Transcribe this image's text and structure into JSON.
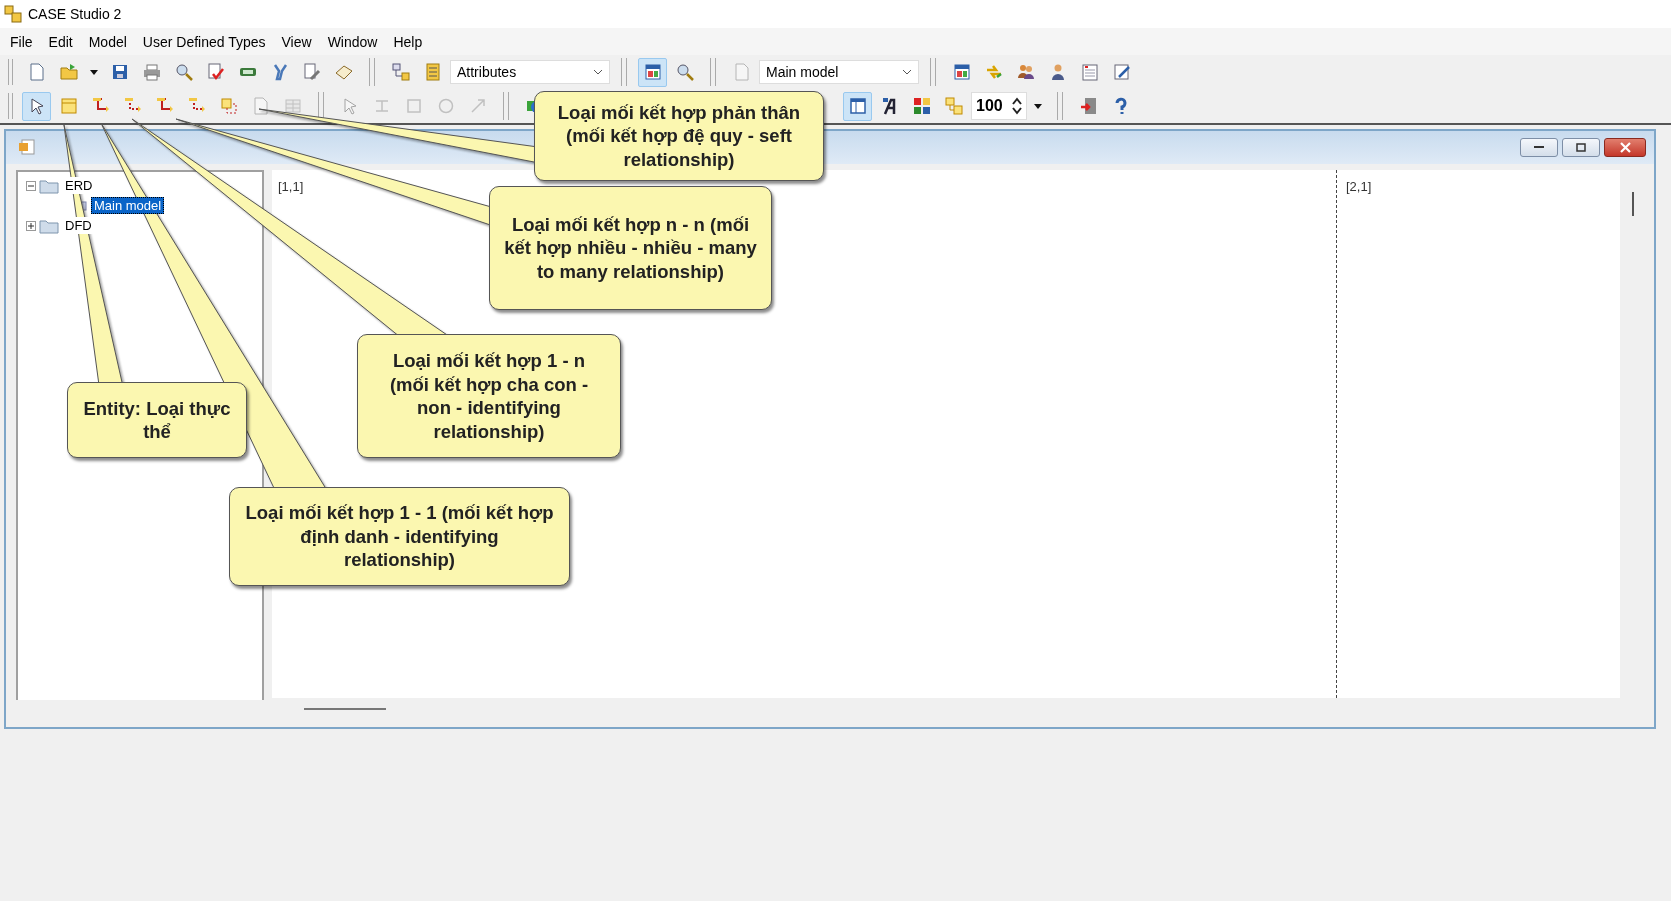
{
  "window": {
    "title": "CASE Studio 2"
  },
  "menu": [
    {
      "label": "File"
    },
    {
      "label": "Edit"
    },
    {
      "label": "Model"
    },
    {
      "label": "User Defined Types"
    },
    {
      "label": "View"
    },
    {
      "label": "Window"
    },
    {
      "label": "Help"
    }
  ],
  "toolbar_top": [
    {
      "kind": "button",
      "selected": false,
      "disabled": false
    },
    {
      "kind": "button",
      "selected": false,
      "disabled": false
    },
    {
      "kind": "dropdown"
    },
    {
      "kind": "button",
      "selected": false,
      "disabled": false
    },
    {
      "kind": "button",
      "selected": false,
      "disabled": false
    },
    {
      "kind": "button",
      "selected": false,
      "disabled": false
    },
    {
      "kind": "button",
      "selected": false,
      "disabled": false
    },
    {
      "kind": "button",
      "selected": false,
      "disabled": false
    },
    {
      "kind": "button",
      "selected": false,
      "disabled": false
    },
    {
      "kind": "button",
      "selected": false,
      "disabled": false
    },
    {
      "kind": "button",
      "selected": false,
      "disabled": false
    },
    {
      "kind": "separator"
    },
    {
      "kind": "button",
      "selected": false,
      "disabled": false
    },
    {
      "kind": "button",
      "selected": false,
      "disabled": false
    },
    {
      "kind": "combo",
      "value": "Attributes"
    },
    {
      "kind": "separator"
    },
    {
      "kind": "button",
      "selected": true,
      "disabled": false
    },
    {
      "kind": "button",
      "selected": false,
      "disabled": false
    },
    {
      "kind": "separator"
    },
    {
      "kind": "button",
      "selected": false,
      "disabled": true
    },
    {
      "kind": "combo",
      "value": "Main model"
    },
    {
      "kind": "separator"
    },
    {
      "kind": "button",
      "selected": false,
      "disabled": false
    },
    {
      "kind": "button",
      "selected": false,
      "disabled": false
    },
    {
      "kind": "button",
      "selected": false,
      "disabled": false
    },
    {
      "kind": "button",
      "selected": false,
      "disabled": false
    },
    {
      "kind": "button",
      "selected": false,
      "disabled": false
    },
    {
      "kind": "button",
      "selected": false,
      "disabled": false
    }
  ],
  "toolbar_bottom": {
    "left": [
      {
        "kind": "button",
        "selected": true,
        "disabled": false
      },
      {
        "kind": "button",
        "selected": false,
        "disabled": false
      },
      {
        "kind": "button",
        "selected": false,
        "disabled": false
      },
      {
        "kind": "button",
        "selected": false,
        "disabled": false
      },
      {
        "kind": "button",
        "selected": false,
        "disabled": false
      },
      {
        "kind": "button",
        "selected": false,
        "disabled": false
      },
      {
        "kind": "button",
        "selected": false,
        "disabled": false
      },
      {
        "kind": "button",
        "selected": false,
        "disabled": true
      },
      {
        "kind": "button",
        "selected": false,
        "disabled": true
      },
      {
        "kind": "separator"
      },
      {
        "kind": "button",
        "selected": false,
        "disabled": true
      },
      {
        "kind": "button",
        "selected": false,
        "disabled": true
      },
      {
        "kind": "button",
        "selected": false,
        "disabled": true
      },
      {
        "kind": "button",
        "selected": false,
        "disabled": true
      },
      {
        "kind": "button",
        "selected": false,
        "disabled": true
      },
      {
        "kind": "separator"
      },
      {
        "kind": "button",
        "selected": false,
        "disabled": false
      }
    ],
    "right": [
      {
        "kind": "button",
        "selected": true,
        "disabled": false
      },
      {
        "kind": "button",
        "selected": false,
        "disabled": false
      },
      {
        "kind": "button",
        "selected": false,
        "disabled": false
      },
      {
        "kind": "button",
        "selected": false,
        "disabled": false
      },
      {
        "kind": "spin",
        "value": "100"
      },
      {
        "kind": "dropdown"
      },
      {
        "kind": "separator"
      },
      {
        "kind": "button",
        "selected": false,
        "disabled": false
      },
      {
        "kind": "button",
        "selected": false,
        "disabled": false
      }
    ]
  },
  "tree": [
    {
      "label": "ERD",
      "expanded": true,
      "selected": false,
      "children": [
        {
          "label": "Main model",
          "selected": true
        }
      ]
    },
    {
      "label": "DFD",
      "expanded": false,
      "selected": false
    }
  ],
  "canvas": {
    "page_labels": [
      "[1,1]",
      "[2,1]"
    ]
  },
  "callouts": [
    {
      "text": "Loại mối kết hợp phản thân (mối kết hợp đệ quy - seft relationship)"
    },
    {
      "text": "Loại mối kết hợp n - n (mối kết hợp nhiều - nhiều - many to many relationship)"
    },
    {
      "text": "Entity: Loại thực thể"
    },
    {
      "text": "Loại mối kết hợp 1 - n (mối kết hợp cha con - non - identifying relationship)"
    },
    {
      "text": "Loại mối kết hợp 1 - 1 (mối kết hợp định danh - identifying relationship)"
    }
  ]
}
